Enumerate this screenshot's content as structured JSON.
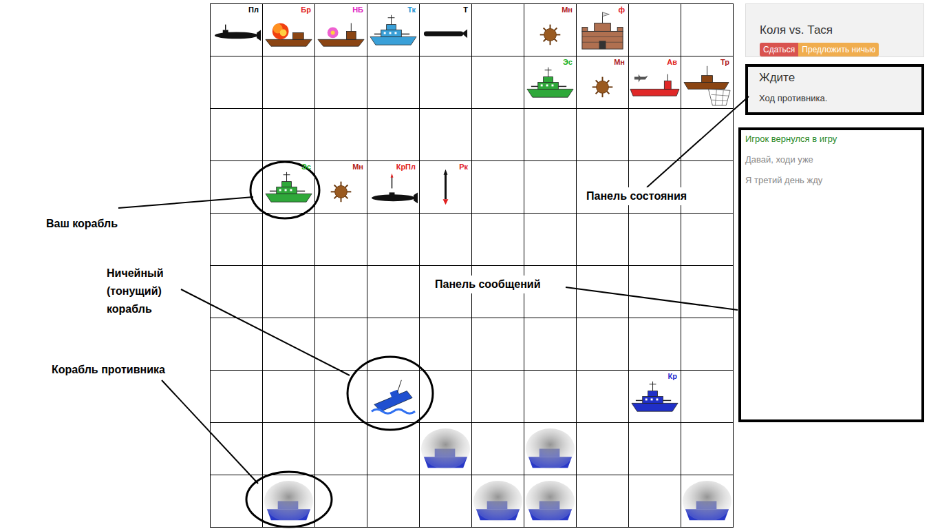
{
  "header": {
    "title": "Коля vs. Тася",
    "buttons": [
      {
        "label": "Сдаться",
        "kind": "danger"
      },
      {
        "label": "Предложить ничью",
        "kind": "warning"
      }
    ]
  },
  "status": {
    "title": "Ждите",
    "text": "Ход противника."
  },
  "messages": [
    {
      "text": "Игрок вернулся в игру",
      "kind": "system"
    },
    {
      "text": "Давай, ходи уже",
      "kind": "chat"
    },
    {
      "text": "Я третий день жду",
      "kind": "chat"
    }
  ],
  "board": {
    "rows": [
      [
        {
          "kind": "submarine",
          "label": "Пл",
          "color": "#000000"
        },
        {
          "kind": "burning-ship",
          "label": "Бр",
          "color": "#e02020"
        },
        {
          "kind": "nuke-ship",
          "label": "НБ",
          "color": "#e020c0"
        },
        {
          "kind": "torpedo-boat",
          "label": "Тк",
          "color": "#2090d0"
        },
        {
          "kind": "torpedo",
          "label": "Т",
          "color": "#000000"
        },
        {
          "kind": "empty"
        },
        {
          "kind": "mine",
          "label": "Мн",
          "color": "#b02020"
        },
        {
          "kind": "fort",
          "label": "ф",
          "color": "#e02020"
        },
        {
          "kind": "empty"
        },
        {
          "kind": "empty"
        }
      ],
      [
        {
          "kind": "empty"
        },
        {
          "kind": "empty"
        },
        {
          "kind": "empty"
        },
        {
          "kind": "empty"
        },
        {
          "kind": "empty"
        },
        {
          "kind": "empty"
        },
        {
          "kind": "escort",
          "label": "Эс",
          "color": "#20b020"
        },
        {
          "kind": "mine",
          "label": "Мн",
          "color": "#b02020"
        },
        {
          "kind": "carrier",
          "label": "Ав",
          "color": "#e02020"
        },
        {
          "kind": "trawler",
          "label": "Тр",
          "color": "#b02020"
        }
      ],
      [
        {
          "kind": "empty"
        },
        {
          "kind": "empty"
        },
        {
          "kind": "empty"
        },
        {
          "kind": "empty"
        },
        {
          "kind": "empty"
        },
        {
          "kind": "empty"
        },
        {
          "kind": "empty"
        },
        {
          "kind": "empty"
        },
        {
          "kind": "empty"
        },
        {
          "kind": "empty"
        }
      ],
      [
        {
          "kind": "empty"
        },
        {
          "kind": "escort",
          "label": "Эс",
          "color": "#20b020"
        },
        {
          "kind": "mine",
          "label": "Мн",
          "color": "#b02020"
        },
        {
          "kind": "missile-sub",
          "label": "КрПл",
          "color": "#e02020"
        },
        {
          "kind": "rocket",
          "label": "Рк",
          "color": "#e02020"
        },
        {
          "kind": "empty"
        },
        {
          "kind": "empty"
        },
        {
          "kind": "empty"
        },
        {
          "kind": "empty"
        },
        {
          "kind": "empty"
        }
      ],
      [
        {
          "kind": "empty"
        },
        {
          "kind": "empty"
        },
        {
          "kind": "empty"
        },
        {
          "kind": "empty"
        },
        {
          "kind": "empty"
        },
        {
          "kind": "empty"
        },
        {
          "kind": "empty"
        },
        {
          "kind": "empty"
        },
        {
          "kind": "empty"
        },
        {
          "kind": "empty"
        }
      ],
      [
        {
          "kind": "empty"
        },
        {
          "kind": "empty"
        },
        {
          "kind": "empty"
        },
        {
          "kind": "empty"
        },
        {
          "kind": "empty"
        },
        {
          "kind": "empty"
        },
        {
          "kind": "empty"
        },
        {
          "kind": "empty"
        },
        {
          "kind": "empty"
        },
        {
          "kind": "empty"
        }
      ],
      [
        {
          "kind": "empty"
        },
        {
          "kind": "empty"
        },
        {
          "kind": "empty"
        },
        {
          "kind": "empty"
        },
        {
          "kind": "empty"
        },
        {
          "kind": "empty"
        },
        {
          "kind": "empty"
        },
        {
          "kind": "empty"
        },
        {
          "kind": "empty"
        },
        {
          "kind": "empty"
        }
      ],
      [
        {
          "kind": "empty"
        },
        {
          "kind": "empty"
        },
        {
          "kind": "empty"
        },
        {
          "kind": "sinking"
        },
        {
          "kind": "empty"
        },
        {
          "kind": "empty"
        },
        {
          "kind": "empty"
        },
        {
          "kind": "empty"
        },
        {
          "kind": "cruiser",
          "label": "Кр",
          "color": "#2030d0"
        },
        {
          "kind": "empty"
        }
      ],
      [
        {
          "kind": "empty"
        },
        {
          "kind": "empty"
        },
        {
          "kind": "empty"
        },
        {
          "kind": "empty"
        },
        {
          "kind": "fog"
        },
        {
          "kind": "empty"
        },
        {
          "kind": "fog"
        },
        {
          "kind": "empty"
        },
        {
          "kind": "empty"
        },
        {
          "kind": "empty"
        }
      ],
      [
        {
          "kind": "empty"
        },
        {
          "kind": "fog"
        },
        {
          "kind": "empty"
        },
        {
          "kind": "empty"
        },
        {
          "kind": "empty"
        },
        {
          "kind": "fog"
        },
        {
          "kind": "fog"
        },
        {
          "kind": "empty"
        },
        {
          "kind": "empty"
        },
        {
          "kind": "fog"
        }
      ]
    ]
  },
  "annotations": [
    {
      "text": "Ваш корабль",
      "kind": "your-ship"
    },
    {
      "text": "Ничейный\n(тонущий)\nкорабль",
      "kind": "neutral-ship"
    },
    {
      "text": "Корабль противника",
      "kind": "enemy-ship"
    },
    {
      "text": "Панель состояния",
      "kind": "status-panel"
    },
    {
      "text": "Панель сообщений",
      "kind": "message-panel"
    }
  ]
}
